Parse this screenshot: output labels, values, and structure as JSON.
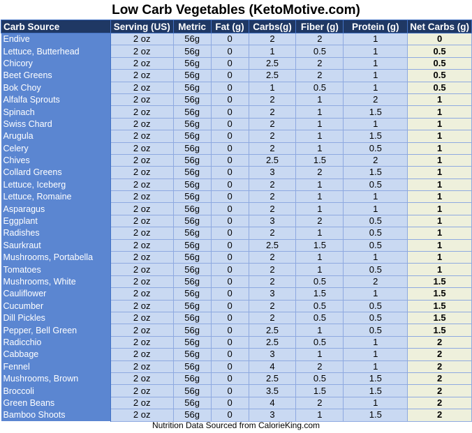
{
  "title": "Low Carb Vegetables (KetoMotive.com)",
  "columns": [
    "Carb Source",
    "Serving (US)",
    "Metric",
    "Fat (g)",
    "Carbs(g)",
    "Fiber (g)",
    "Protein (g)",
    "Net Carbs (g)"
  ],
  "rows": [
    [
      "Endive",
      "2 oz",
      "56g",
      "0",
      "2",
      "2",
      "1",
      "0"
    ],
    [
      "Lettuce, Butterhead",
      "2 oz",
      "56g",
      "0",
      "1",
      "0.5",
      "1",
      "0.5"
    ],
    [
      "Chicory",
      "2 oz",
      "56g",
      "0",
      "2.5",
      "2",
      "1",
      "0.5"
    ],
    [
      "Beet Greens",
      "2 oz",
      "56g",
      "0",
      "2.5",
      "2",
      "1",
      "0.5"
    ],
    [
      "Bok Choy",
      "2 oz",
      "56g",
      "0",
      "1",
      "0.5",
      "1",
      "0.5"
    ],
    [
      "Alfalfa Sprouts",
      "2 oz",
      "56g",
      "0",
      "2",
      "1",
      "2",
      "1"
    ],
    [
      "Spinach",
      "2 oz",
      "56g",
      "0",
      "2",
      "1",
      "1.5",
      "1"
    ],
    [
      "Swiss Chard",
      "2 oz",
      "56g",
      "0",
      "2",
      "1",
      "1",
      "1"
    ],
    [
      "Arugula",
      "2 oz",
      "56g",
      "0",
      "2",
      "1",
      "1.5",
      "1"
    ],
    [
      "Celery",
      "2 oz",
      "56g",
      "0",
      "2",
      "1",
      "0.5",
      "1"
    ],
    [
      "Chives",
      "2 oz",
      "56g",
      "0",
      "2.5",
      "1.5",
      "2",
      "1"
    ],
    [
      "Collard Greens",
      "2 oz",
      "56g",
      "0",
      "3",
      "2",
      "1.5",
      "1"
    ],
    [
      "Lettuce, Iceberg",
      "2 oz",
      "56g",
      "0",
      "2",
      "1",
      "0.5",
      "1"
    ],
    [
      "Lettuce, Romaine",
      "2 oz",
      "56g",
      "0",
      "2",
      "1",
      "1",
      "1"
    ],
    [
      "Asparagus",
      "2 oz",
      "56g",
      "0",
      "2",
      "1",
      "1",
      "1"
    ],
    [
      "Eggplant",
      "2 oz",
      "56g",
      "0",
      "3",
      "2",
      "0.5",
      "1"
    ],
    [
      "Radishes",
      "2 oz",
      "56g",
      "0",
      "2",
      "1",
      "0.5",
      "1"
    ],
    [
      "Saurkraut",
      "2 oz",
      "56g",
      "0",
      "2.5",
      "1.5",
      "0.5",
      "1"
    ],
    [
      "Mushrooms, Portabella",
      "2 oz",
      "56g",
      "0",
      "2",
      "1",
      "1",
      "1"
    ],
    [
      "Tomatoes",
      "2 oz",
      "56g",
      "0",
      "2",
      "1",
      "0.5",
      "1"
    ],
    [
      "Mushrooms, White",
      "2 oz",
      "56g",
      "0",
      "2",
      "0.5",
      "2",
      "1.5"
    ],
    [
      "Cauliflower",
      "2 oz",
      "56g",
      "0",
      "3",
      "1.5",
      "1",
      "1.5"
    ],
    [
      "Cucumber",
      "2 oz",
      "56g",
      "0",
      "2",
      "0.5",
      "0.5",
      "1.5"
    ],
    [
      "Dill Pickles",
      "2 oz",
      "56g",
      "0",
      "2",
      "0.5",
      "0.5",
      "1.5"
    ],
    [
      "Pepper, Bell Green",
      "2 oz",
      "56g",
      "0",
      "2.5",
      "1",
      "0.5",
      "1.5"
    ],
    [
      "Radicchio",
      "2 oz",
      "56g",
      "0",
      "2.5",
      "0.5",
      "1",
      "2"
    ],
    [
      "Cabbage",
      "2 oz",
      "56g",
      "0",
      "3",
      "1",
      "1",
      "2"
    ],
    [
      "Fennel",
      "2 oz",
      "56g",
      "0",
      "4",
      "2",
      "1",
      "2"
    ],
    [
      "Mushrooms, Brown",
      "2 oz",
      "56g",
      "0",
      "2.5",
      "0.5",
      "1.5",
      "2"
    ],
    [
      "Broccoli",
      "2 oz",
      "56g",
      "0",
      "3.5",
      "1.5",
      "1.5",
      "2"
    ],
    [
      "Green Beans",
      "2 oz",
      "56g",
      "0",
      "4",
      "2",
      "1",
      "2"
    ],
    [
      "Bamboo Shoots",
      "2 oz",
      "56g",
      "0",
      "3",
      "1",
      "1.5",
      "2"
    ]
  ],
  "footer": "Nutrition Data Sourced from CalorieKing.com",
  "colors": {
    "header_bg": "#1f3864",
    "source_col_bg": "#5b86d1",
    "cell_bg": "#c9d9f2",
    "net_carbs_bg": "#eef0dc"
  }
}
